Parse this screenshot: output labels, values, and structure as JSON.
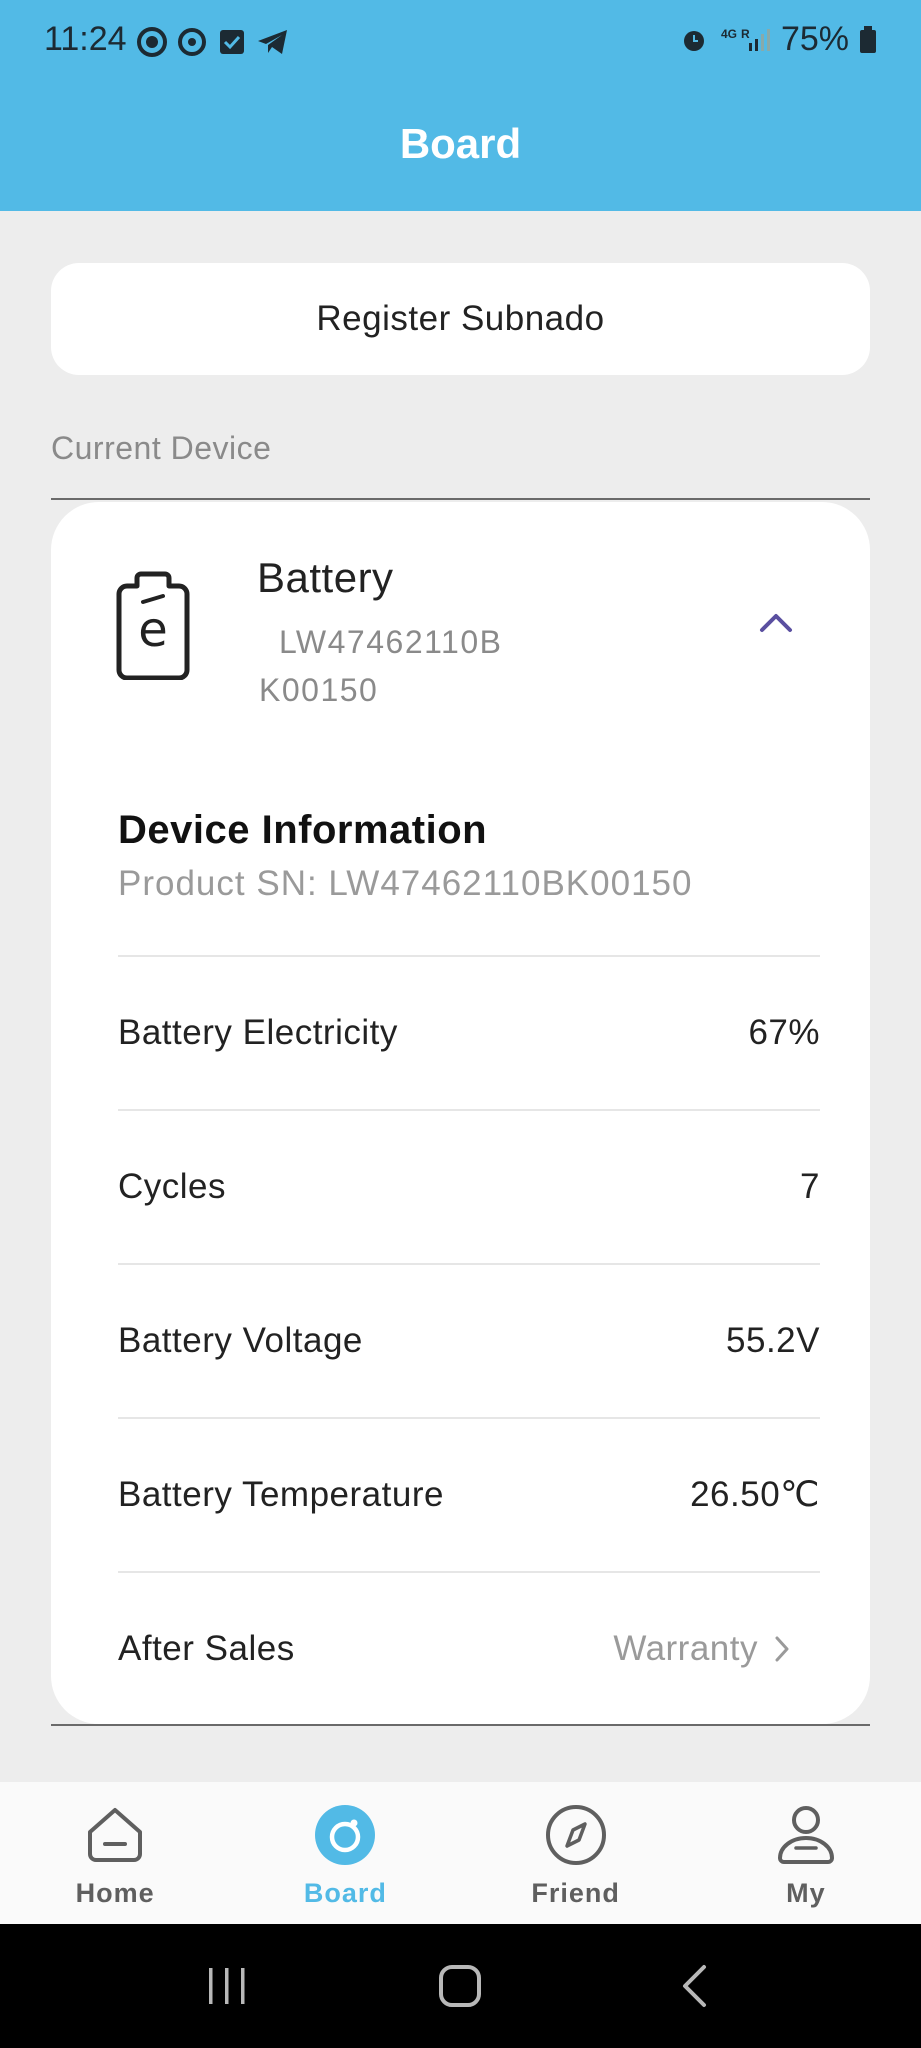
{
  "status_bar": {
    "time": "11:24",
    "battery_percent": "75%"
  },
  "header": {
    "title": "Board"
  },
  "register": {
    "label": "Register Subnado"
  },
  "current_device": {
    "section_label": "Current Device",
    "device_name": "Battery",
    "sn_line1": "LW47462110B",
    "sn_line2": "K00150"
  },
  "device_info": {
    "title": "Device Information",
    "sn_prefix": "Product SN: ",
    "sn_value": "LW47462110BK00150",
    "rows": [
      {
        "label": "Battery Electricity",
        "value": "67%"
      },
      {
        "label": "Cycles",
        "value": "7"
      },
      {
        "label": "Battery Voltage",
        "value": "55.2V"
      },
      {
        "label": "Battery Temperature",
        "value": "26.50℃"
      },
      {
        "label": "After Sales",
        "value": "Warranty"
      }
    ]
  },
  "bottom_nav": {
    "items": [
      {
        "label": "Home",
        "icon": "home-icon"
      },
      {
        "label": "Board",
        "icon": "board-icon",
        "active": true
      },
      {
        "label": "Friend",
        "icon": "compass-icon"
      },
      {
        "label": "My",
        "icon": "person-icon"
      }
    ]
  },
  "colors": {
    "accent": "#52bae6",
    "collapse_arrow": "#5a4fa0"
  }
}
